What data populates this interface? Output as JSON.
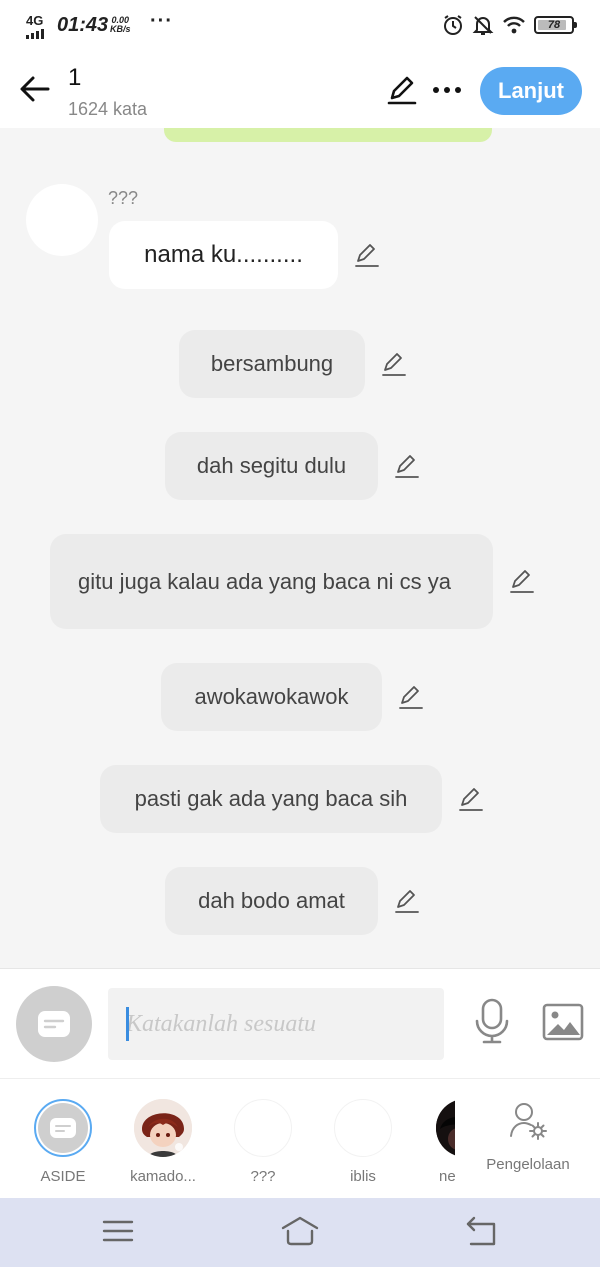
{
  "status_bar": {
    "network": "4G",
    "time": "01:43",
    "speed_value": "0.00",
    "speed_unit": "KB/s",
    "battery_level": "78",
    "icons": [
      "alarm-icon",
      "bell-off-icon",
      "wifi-icon",
      "battery-icon"
    ]
  },
  "header": {
    "chapter_title": "1",
    "word_count": "1624 kata",
    "next_label": "Lanjut",
    "icons": [
      "back-arrow-icon",
      "pencil-icon",
      "more-dots-icon"
    ]
  },
  "chat": {
    "speaker_name": "???",
    "messages": [
      {
        "text": "nama ku.........."
      },
      {
        "text": "bersambung"
      },
      {
        "text": "dah segitu dulu"
      },
      {
        "text": "gitu juga kalau ada yang baca ni cs ya"
      },
      {
        "text": "awokawokawok"
      },
      {
        "text": "pasti gak ada yang baca sih"
      },
      {
        "text": "dah bodo amat"
      }
    ]
  },
  "input": {
    "placeholder": "Katakanlah sesuatu",
    "value": "",
    "icons": [
      "aside-chat-icon",
      "microphone-icon",
      "image-icon"
    ]
  },
  "characters": [
    {
      "name": "ASIDE",
      "selected": true
    },
    {
      "name": "kamado..."
    },
    {
      "name": "???"
    },
    {
      "name": "iblis"
    },
    {
      "name": "ne"
    }
  ],
  "management": {
    "label": "Pengelolaan",
    "icon": "user-gear-icon"
  },
  "nav": {
    "icons": [
      "menu-icon",
      "home-icon",
      "back-icon"
    ]
  },
  "colors": {
    "accent": "#5aaaf2",
    "bubble": "#ebebeb",
    "nav_bar": "#dde1f2",
    "highlight": "#d7f1a8"
  }
}
